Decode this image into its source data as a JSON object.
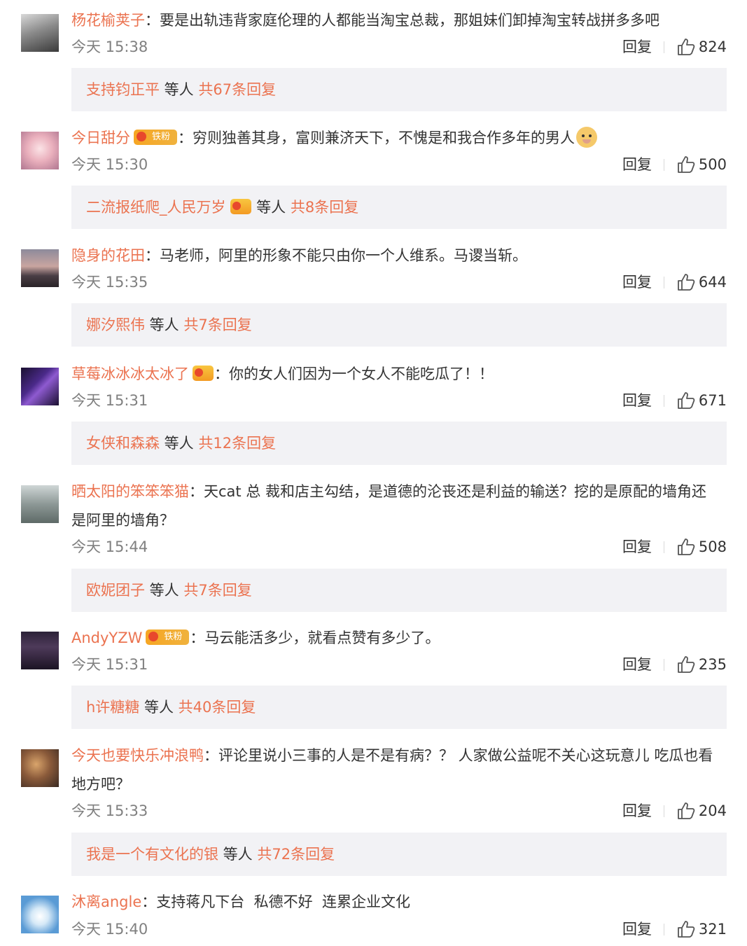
{
  "ui": {
    "reply_label": "回复",
    "colon": "："
  },
  "comments": [
    {
      "nickname": "杨花榆荚子",
      "text": "要是出轨违背家庭伦理的人都能当淘宝总裁，那姐妹们卸掉淘宝转战拼多多吧",
      "time": "今天 15:38",
      "likes": "824",
      "replies": {
        "first": "支持钧正平",
        "etc": " 等人 ",
        "total": "共67条回复"
      },
      "avatar_color": "#6e6e6e"
    },
    {
      "nickname": "今日甜分",
      "badge_text": "铁粉",
      "text": "穷则独善其身，富则兼济天下，不愧是和我合作多年的男人",
      "time": "今天 15:30",
      "likes": "500",
      "replies": {
        "first": "二流报纸爬_人民万岁",
        "etc": " 等人 ",
        "total": "共8条回复"
      },
      "avatar_color": "#e7a3b3"
    },
    {
      "nickname": "隐身的花田",
      "text": "马老师，阿里的形象不能只由你一个人维系。马谡当斩。",
      "time": "今天 15:35",
      "likes": "644",
      "replies": {
        "first": "娜汐熙伟",
        "etc": " 等人 ",
        "total": "共7条回复"
      },
      "avatar_color": "#7a6a73"
    },
    {
      "nickname": "草莓冰冰冰太冰了",
      "text": "你的女人们因为一个女人不能吃瓜了！！",
      "time": "今天 15:31",
      "likes": "671",
      "replies": {
        "first": "女侠和森森",
        "etc": " 等人 ",
        "total": "共12条回复"
      },
      "avatar_color": "#3a2a6b"
    },
    {
      "nickname": "晒太阳的笨笨笨猫",
      "text": "天cat 总 裁和店主勾结，是道德的沦丧还是利益的输送？挖的是原配的墙角还",
      "text2": "是阿里的墙角？",
      "time": "今天 15:44",
      "likes": "508",
      "replies": {
        "first": "欧妮团子",
        "etc": " 等人 ",
        "total": "共7条回复"
      },
      "avatar_color": "#9aa3a6"
    },
    {
      "nickname": "AndyYZW",
      "badge_text": "铁粉",
      "text": "马云能活多少，就看点赞有多少了。",
      "time": "今天 15:31",
      "likes": "235",
      "replies": {
        "first": "h许糖糖",
        "etc": " 等人 ",
        "total": "共40条回复"
      },
      "avatar_color": "#3b2a4a"
    },
    {
      "nickname": "今天也要快乐冲浪鸭",
      "text": "评论里说小三事的人是不是有病？？ 人家做公益呢不关心这玩意儿 吃瓜也看",
      "text2": "地方吧？",
      "time": "今天 15:33",
      "likes": "204",
      "replies": {
        "first": "我是一个有文化的银",
        "etc": " 等人 ",
        "total": "共72条回复"
      },
      "avatar_color": "#5b4636"
    },
    {
      "nickname": "沐离angle",
      "text": "支持蒋凡下台  私德不好  连累企业文化",
      "time": "今天 15:40",
      "likes": "321",
      "avatar_color": "#5a9bd5"
    }
  ]
}
